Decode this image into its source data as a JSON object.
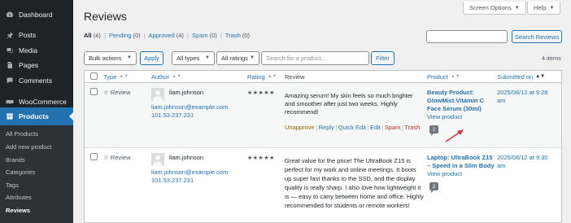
{
  "sidebar": {
    "menu": [
      {
        "label": "Dashboard",
        "icon": "dashboard-icon"
      },
      {
        "label": "Posts",
        "icon": "pin-icon"
      },
      {
        "label": "Media",
        "icon": "media-icon"
      },
      {
        "label": "Pages",
        "icon": "page-icon"
      },
      {
        "label": "Comments",
        "icon": "comment-icon"
      },
      {
        "label": "WooCommerce",
        "icon": "woocommerce-icon"
      },
      {
        "label": "Products",
        "icon": "archive-icon"
      }
    ],
    "submenu": [
      "All Products",
      "Add new product",
      "Brands",
      "Categories",
      "Tags",
      "Attributes",
      "Reviews"
    ]
  },
  "header": {
    "title": "Reviews",
    "screen_options": "Screen Options",
    "help": "Help"
  },
  "filters": {
    "all": "All",
    "all_count": "(4)",
    "pending": "Pending",
    "pending_count": "(0)",
    "approved": "Approved",
    "approved_count": "(4)",
    "spam": "Spam",
    "spam_count": "(0)",
    "trash": "Trash",
    "trash_count": "(0)",
    "separator": "|"
  },
  "search": {
    "button": "Search Reviews"
  },
  "toolbar": {
    "bulk_actions": "Bulk actions",
    "apply": "Apply",
    "all_types": "All types",
    "all_ratings": "All ratings",
    "product_placeholder": "Search for a product...",
    "filter": "Filter",
    "items_count": "4 items"
  },
  "table": {
    "columns": [
      "Type",
      "Author",
      "Rating",
      "Review",
      "Product",
      "Submitted on"
    ],
    "rows": [
      {
        "type": "☆ Review",
        "author_name": "liam.johnson",
        "author_email": "liam.johnson@example.com",
        "author_ip": "101.53.237.231",
        "rating": "★★★★★",
        "review_lines": [
          "Amazing serum! My skin feels so much brighter",
          "and smoother after just two weeks. Highly",
          "recommend!"
        ],
        "actions": {
          "unapprove": "Unapprove",
          "reply": "Reply",
          "quick_edit": "Quick Edit",
          "edit": "Edit",
          "spam": "Spam",
          "trash": "Trash"
        },
        "product_lines": [
          "Beauty Product:",
          "GlowMist Vitamin C",
          "Face Serum (30ml)"
        ],
        "view_product": "View product",
        "comment_count": "2",
        "submitted_lines": [
          "2025/08/12 at 9:28",
          "am"
        ]
      },
      {
        "type": "☆ Review",
        "author_name": "liam.johnson",
        "author_email": "liam.johnson@example.com",
        "author_ip": "101.53.237.231",
        "rating": "★★★★★",
        "review_lines": [
          "Great value for the price! The UltraBook Z15 is",
          "perfect for my work and online meetings. It boots",
          "up super fast thanks to the SSD, and the display",
          "quality is really sharp. I also love how lightweight it",
          "is — easy to carry between home and office. Highly",
          "recommended for students or remote workers!"
        ],
        "product_lines": [
          "Laptop: UltraBook Z15",
          "– Speed in a Slim Body"
        ],
        "view_product": "View product",
        "comment_count": "2",
        "submitted_lines": [
          "2025/08/12 at 9:30",
          "am"
        ]
      }
    ]
  },
  "colors": {
    "accent": "#2271b1",
    "sidebar": "#1d2327",
    "arrow": "#d63638"
  }
}
